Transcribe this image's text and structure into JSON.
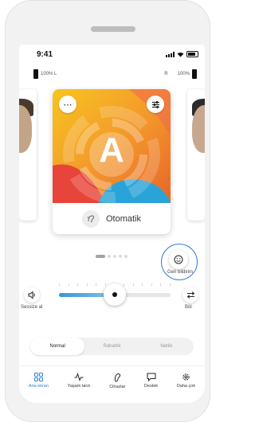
{
  "status": {
    "time": "9:41"
  },
  "hearing_aids": {
    "left_label": "100% L",
    "right_prefix": "R",
    "right_value": "100%"
  },
  "program_card": {
    "letter": "A",
    "name": "Otomatik",
    "more_icon": "more-icon",
    "settings_icon": "sliders-icon"
  },
  "pager": {
    "count": 5,
    "active": 1
  },
  "feedback": {
    "label": "Geri bildirim"
  },
  "volume": {
    "mute_label": "Sessize al",
    "split_label": "Böl",
    "level": 0.5
  },
  "segments": [
    {
      "label": "Normal",
      "selected": true
    },
    {
      "label": "Rahatlık",
      "selected": false
    },
    {
      "label": "Netlik",
      "selected": false
    }
  ],
  "tabs": [
    {
      "label": "Ana ekran",
      "icon": "grid-icon",
      "active": true
    },
    {
      "label": "Yaşam tarzı",
      "icon": "pulse-icon",
      "active": false
    },
    {
      "label": "Cihazlar",
      "icon": "hearing-aid-icon",
      "active": false
    },
    {
      "label": "Destek",
      "icon": "chat-icon",
      "active": false
    },
    {
      "label": "Daha çok",
      "icon": "gear-icon",
      "active": false
    }
  ],
  "colors": {
    "accent": "#2f7fd1",
    "slider_start": "#3a97d6",
    "card_orange": "#f08a2a"
  }
}
